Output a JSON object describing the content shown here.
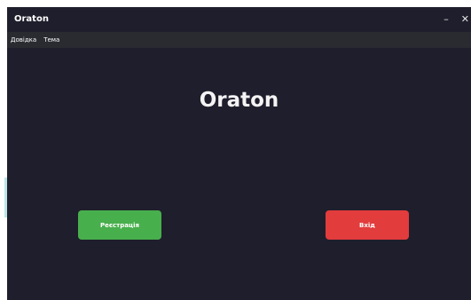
{
  "window": {
    "title": "Oraton",
    "minimize_label": "–",
    "close_label": "✕"
  },
  "menu": {
    "items": [
      "Довідка",
      "Тема"
    ]
  },
  "main": {
    "heading": "Oraton",
    "register_button": "Реєстрація",
    "login_button": "Вхід"
  },
  "colors": {
    "background": "#1f1e2c",
    "menubar": "#2a2b31",
    "register": "#48af4d",
    "login": "#e23c3c"
  }
}
